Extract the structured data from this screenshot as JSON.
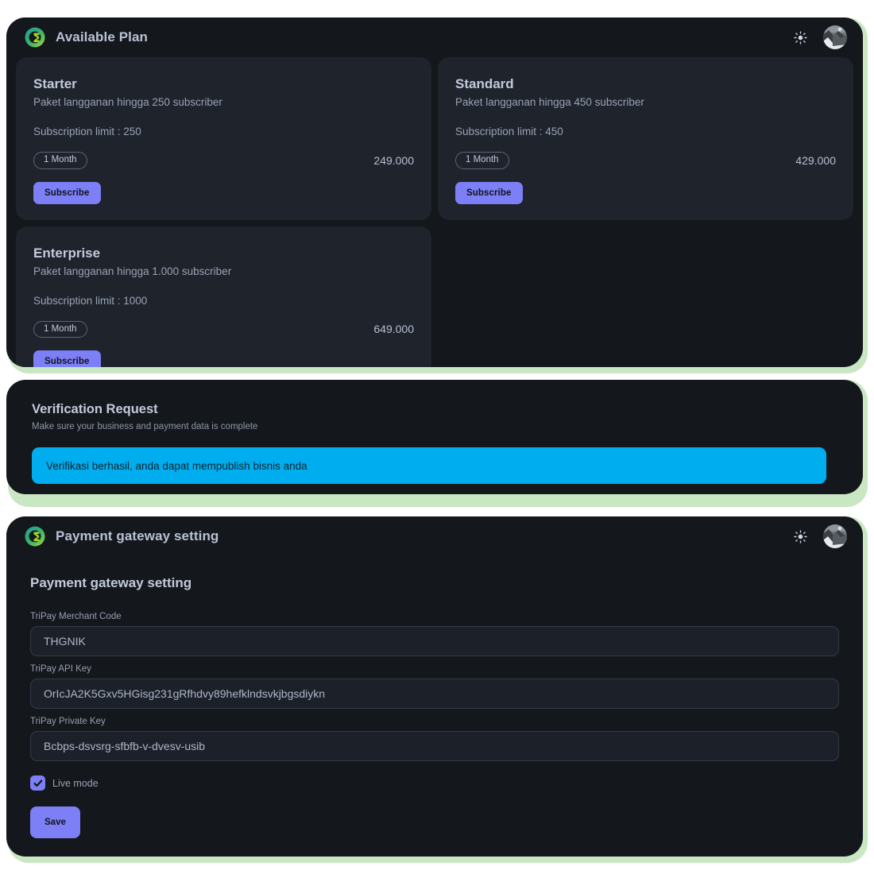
{
  "plans_window": {
    "header": {
      "logo_icon": "brand-logo-icon",
      "title": "Available Plan",
      "theme_toggle_icon": "sun-icon",
      "avatar_icon": "user-avatar"
    },
    "cards": [
      {
        "name": "Starter",
        "description": "Paket langganan hingga 250 subscriber",
        "limit": "Subscription limit : 250",
        "duration": "1 Month",
        "price": "249.000",
        "button": "Subscribe"
      },
      {
        "name": "Standard",
        "description": "Paket langganan hingga 450 subscriber",
        "limit": "Subscription limit : 450",
        "duration": "1 Month",
        "price": "429.000",
        "button": "Subscribe"
      },
      {
        "name": "Enterprise",
        "description": "Paket langganan hingga 1.000 subscriber",
        "limit": "Subscription limit : 1000",
        "duration": "1 Month",
        "price": "649.000",
        "button": "Subscribe"
      }
    ]
  },
  "verification_window": {
    "title": "Verification Request",
    "subtitle": "Make sure your business and payment data is complete",
    "alert": {
      "message": "Verifikasi berhasil, anda dapat mempublish bisnis anda",
      "color": "#00AEEF"
    }
  },
  "payment_window": {
    "header": {
      "logo_icon": "brand-logo-icon",
      "title": "Payment gateway setting",
      "theme_toggle_icon": "sun-icon",
      "avatar_icon": "user-avatar"
    },
    "section_title": "Payment gateway setting",
    "fields": [
      {
        "label": "TriPay Merchant Code",
        "value": "THGNIK",
        "placeholder": "TriPay Merchant Code"
      },
      {
        "label": "TriPay API Key",
        "value": "OrIcJA2K5Gxv5HGisg231gRfhdvy89hefklndsvkjbgsdiykn",
        "placeholder": "TriPay API Key"
      },
      {
        "label": "TriPay Private Key",
        "value": "Bcbps-dsvsrg-sfbfb-v-dvesv-usib",
        "placeholder": "TriPay Private Key"
      }
    ],
    "live_mode": {
      "label": "Live mode",
      "checked": true
    },
    "save_button": "Save"
  },
  "theme": {
    "accent": "#7C7FF5",
    "panel_green": "#C9E7C2",
    "window_bg": "#14171C",
    "card_bg": "#1E232C",
    "info_blue": "#00AEEF"
  }
}
